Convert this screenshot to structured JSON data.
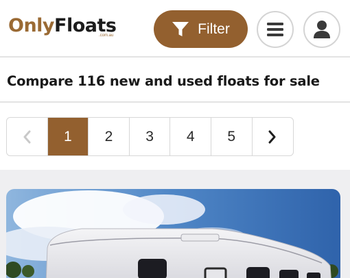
{
  "header": {
    "logo_main_part1": "Only",
    "logo_main_part2": "Floats",
    "logo_sub": ".com.au",
    "filter_label": "Filter",
    "icons": {
      "filter": "filter-funnel-icon",
      "menu": "hamburger-menu-icon",
      "user": "user-icon"
    }
  },
  "page_heading": "Compare 116 new and used floats for sale",
  "pagination": {
    "prev_icon": "chevron-left-icon",
    "pages": [
      "1",
      "2",
      "3",
      "4",
      "5"
    ],
    "active_page": "1",
    "next_icon": "chevron-right-icon"
  },
  "colors": {
    "accent": "#93602f",
    "text": "#1a1a1a",
    "divider": "#e3e3e3",
    "band": "#efeff1"
  }
}
